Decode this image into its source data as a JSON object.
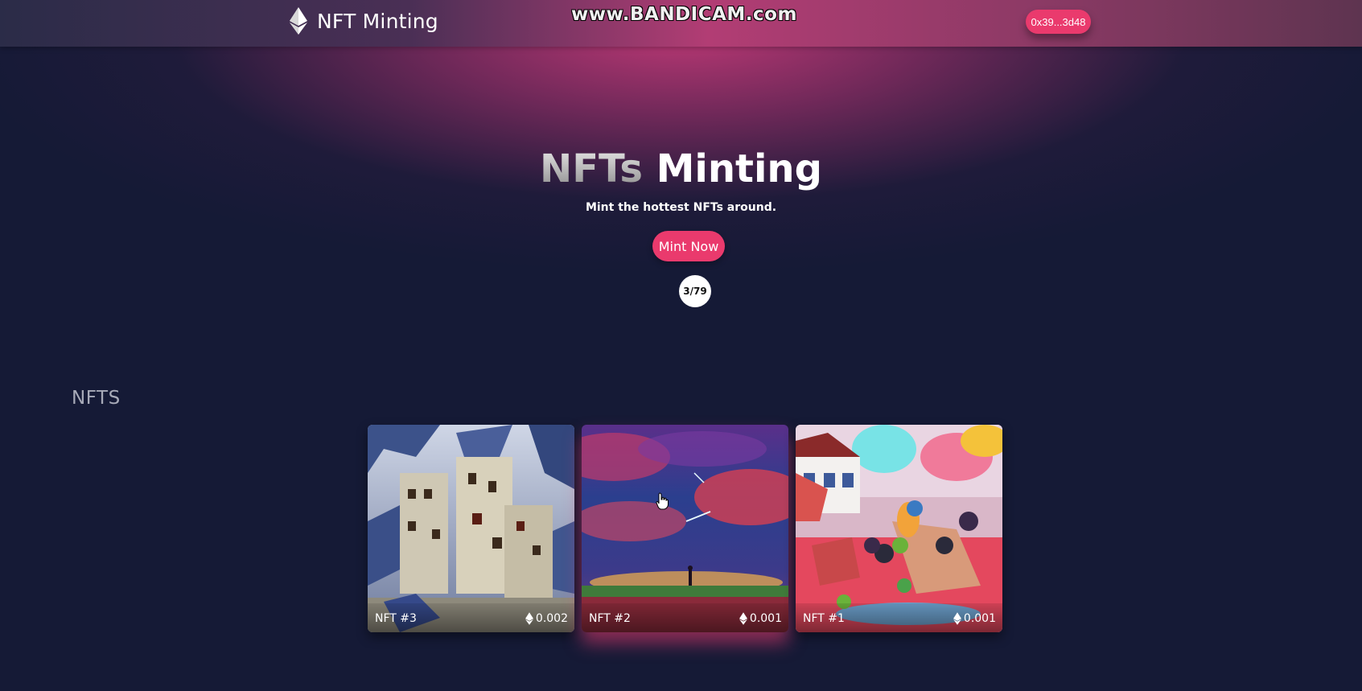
{
  "header": {
    "brand_icon": "ethereum-icon",
    "brand_title": "NFT Minting",
    "watermark": "www.BANDICAM.com",
    "wallet_label": "0x39...3d48"
  },
  "hero": {
    "title_part1": "NFTs",
    "title_part2": "Minting",
    "subtitle": "Mint the hottest NFTs around.",
    "mint_button": "Mint Now",
    "minted_counter": "3/79"
  },
  "gallery": {
    "section_title": "NFTS",
    "cards": [
      {
        "name": "NFT #3",
        "price": "0.002",
        "price_icon": "ethereum-icon"
      },
      {
        "name": "NFT #2",
        "price": "0.001",
        "price_icon": "ethereum-icon"
      },
      {
        "name": "NFT #1",
        "price": "0.001",
        "price_icon": "ethereum-icon"
      }
    ]
  },
  "colors": {
    "accent": "#ea3a6d",
    "background": "#151a36",
    "header_glow": "#b23d74"
  }
}
